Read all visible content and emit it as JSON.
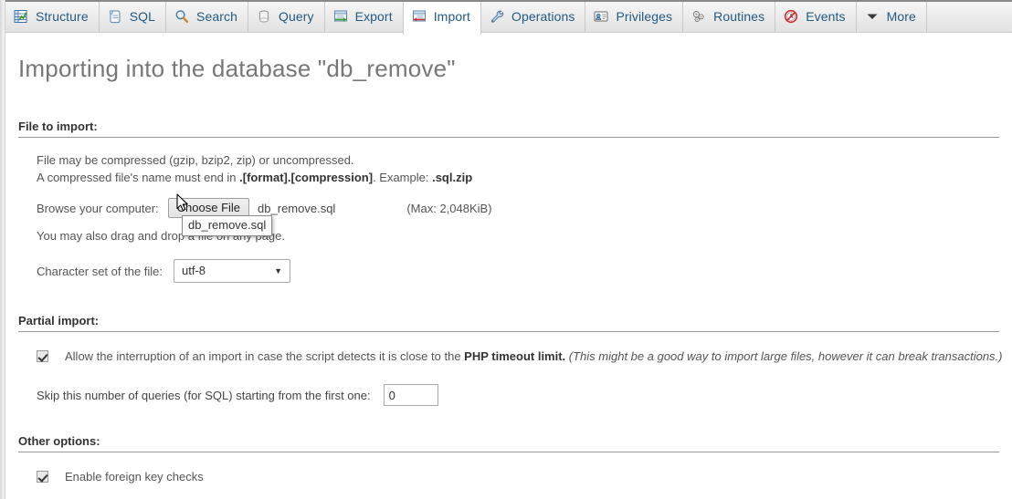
{
  "tabs": [
    {
      "label": "Structure",
      "icon": "structure-icon",
      "active": false
    },
    {
      "label": "SQL",
      "icon": "sql-icon",
      "active": false
    },
    {
      "label": "Search",
      "icon": "search-icon",
      "active": false
    },
    {
      "label": "Query",
      "icon": "query-icon",
      "active": false
    },
    {
      "label": "Export",
      "icon": "export-icon",
      "active": false
    },
    {
      "label": "Import",
      "icon": "import-icon",
      "active": true
    },
    {
      "label": "Operations",
      "icon": "wrench-icon",
      "active": false
    },
    {
      "label": "Privileges",
      "icon": "privileges-icon",
      "active": false
    },
    {
      "label": "Routines",
      "icon": "routines-icon",
      "active": false
    },
    {
      "label": "Events",
      "icon": "events-icon",
      "active": false
    },
    {
      "label": "More",
      "icon": "chevron-down-icon",
      "active": false
    }
  ],
  "page": {
    "title": "Importing into the database \"db_remove\""
  },
  "file_section": {
    "legend": "File to import:",
    "note_line1": "File may be compressed (gzip, bzip2, zip) or uncompressed.",
    "note_line2_prefix": "A compressed file's name must end in ",
    "note_line2_bold1": ".[format].[compression]",
    "note_line2_mid": ". Example: ",
    "note_line2_bold2": ".sql.zip",
    "browse_label": "Browse your computer:",
    "choose_button": "Choose File",
    "selected_file": "db_remove.sql",
    "max_size": "(Max: 2,048KiB)",
    "dragdrop_text": "You may also drag and drop a file on any page.",
    "charset_label": "Character set of the file:",
    "charset_value": "utf-8",
    "charset_arrow": "▼"
  },
  "tooltip": {
    "text": "db_remove.sql"
  },
  "partial_section": {
    "legend": "Partial import:",
    "allow_interrupt_prefix": "Allow the interruption of an import in case the script detects it is close to the ",
    "allow_interrupt_bold": "PHP timeout limit.",
    "allow_interrupt_italic": " (This might be a good way to import large files, however it can break transactions.)",
    "allow_interrupt_checked": true,
    "skip_label": "Skip this number of queries (for SQL) starting from the first one:",
    "skip_value": "0"
  },
  "other_section": {
    "legend": "Other options:",
    "fk_label": "Enable foreign key checks",
    "fk_checked": true
  },
  "colors": {
    "tab_link": "#235a81",
    "title": "#777777",
    "text": "#555555",
    "rule": "#999999"
  }
}
